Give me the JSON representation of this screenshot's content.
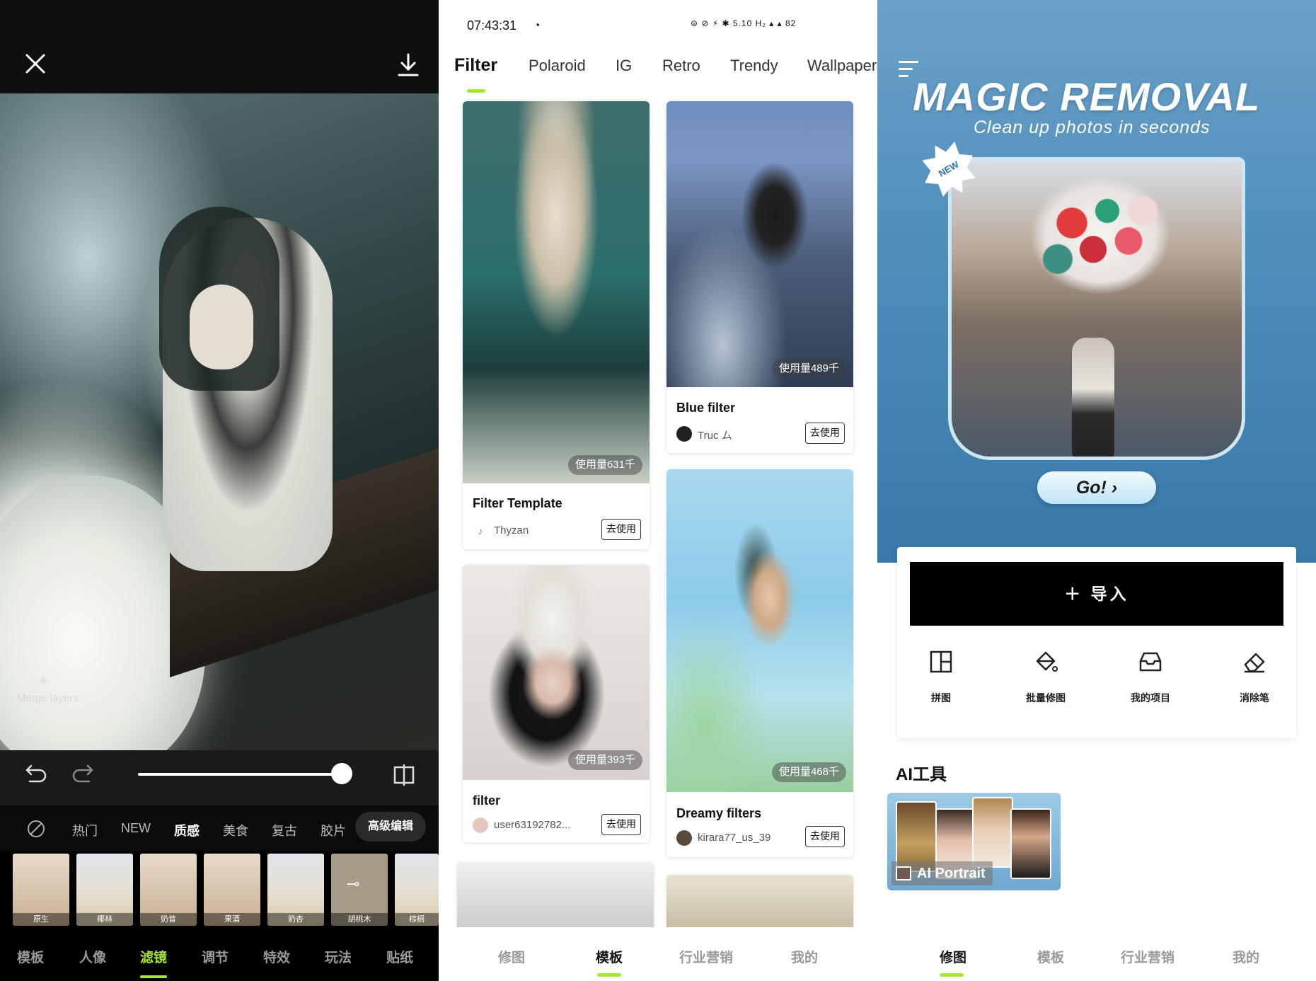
{
  "panel1": {
    "close_icon": "close-icon",
    "download_icon": "download-icon",
    "merge_label": "Merge layers",
    "categories": [
      "热门",
      "NEW",
      "质感",
      "美食",
      "复古",
      "胶片"
    ],
    "advanced_label": "高级编辑",
    "thumbs": [
      "原生",
      "椰林",
      "奶昔",
      "果酒",
      "奶杏",
      "胡桃木",
      "棕榈"
    ],
    "nav": [
      "模板",
      "人像",
      "滤镜",
      "调节",
      "特效",
      "玩法",
      "贴纸"
    ],
    "slider_value": 0.87,
    "accent": "#a8e631"
  },
  "panel2": {
    "status_time": "07:43:31",
    "status_icons": "⊜ ⊘ ⚡ ✱ 5.10 H₂ ▴ ▴ 82",
    "tabs": [
      "Filter",
      "Polaroid",
      "IG",
      "Retro",
      "Trendy",
      "Wallpaper"
    ],
    "cards": [
      {
        "title": "Filter Template",
        "user": "Thyzan",
        "usage": "使用量631千",
        "btn": "去使用"
      },
      {
        "title": "Blue filter",
        "user": "Truc ム",
        "usage": "使用量489千",
        "btn": "去使用"
      },
      {
        "title": "filter",
        "user": "user63192782...",
        "usage": "使用量393千",
        "btn": "去使用"
      },
      {
        "title": "Dreamy filters",
        "user": "kirara77_us_39",
        "usage": "使用量468千",
        "btn": "去使用"
      }
    ],
    "nav": [
      "修图",
      "模板",
      "行业营销",
      "我的"
    ]
  },
  "panel3": {
    "banner_title": "MAGIC REMOVAL",
    "banner_sub": "Clean up photos in seconds",
    "new_badge": "NEW",
    "go_label": "Go! ›",
    "import_label": "＋ 导入",
    "tools": [
      {
        "label": "拼图",
        "icon": "grid-icon"
      },
      {
        "label": "批量修图",
        "icon": "paint-bucket-icon"
      },
      {
        "label": "我的项目",
        "icon": "inbox-icon"
      },
      {
        "label": "消除笔",
        "icon": "eraser-icon"
      }
    ],
    "ai_title": "AI工具",
    "ai_card_label": "AI Portrait",
    "nav": [
      "修图",
      "模板",
      "行业营销",
      "我的"
    ]
  }
}
